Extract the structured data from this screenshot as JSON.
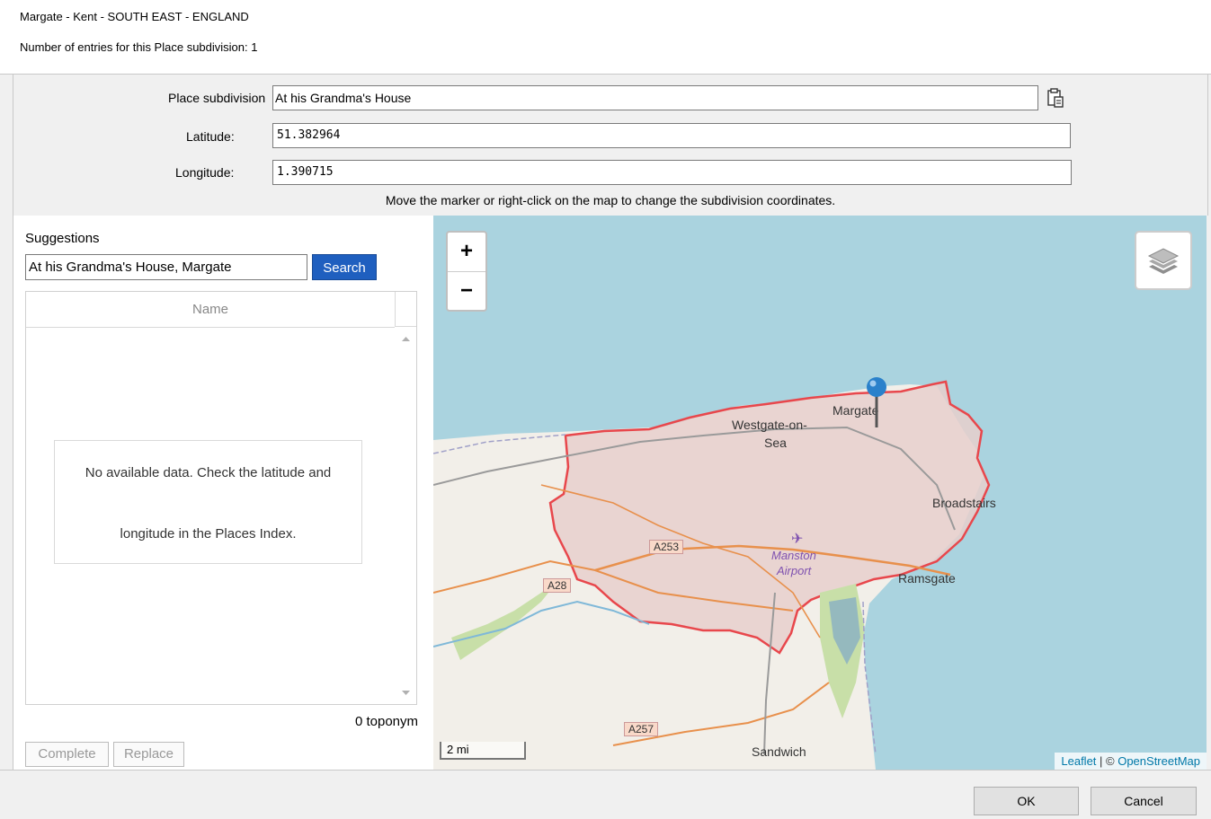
{
  "header": {
    "place_title": "Margate - Kent - SOUTH EAST - ENGLAND",
    "entries_count": "Number of entries for this Place subdivision: 1"
  },
  "form": {
    "subdivision_label": "Place subdivision",
    "subdivision_value": "At his Grandma's House",
    "latitude_label": "Latitude:",
    "latitude_value": "51.382964",
    "longitude_label": "Longitude:",
    "longitude_value": "1.390715",
    "hint": "Move the marker or right-click on the map to change the subdivision coordinates.",
    "paste_icon": "clipboard-paste-icon"
  },
  "suggestions": {
    "label": "Suggestions",
    "query": "At his Grandma's House, Margate",
    "search_label": "Search",
    "column_name": "Name",
    "empty_line1": "No available data. Check the latitude and",
    "empty_line2": "longitude in the Places Index.",
    "count": "0 toponym",
    "complete_label": "Complete",
    "replace_label": "Replace"
  },
  "map": {
    "zoom_in": "+",
    "zoom_out": "−",
    "scale": "2 mi",
    "attribution_leaflet": "Leaflet",
    "attribution_sep": " | © ",
    "attribution_osm": "OpenStreetMap",
    "labels": {
      "margate": "Margate",
      "westgate1": "Westgate-on-",
      "westgate2": "Sea",
      "broadstairs": "Broadstairs",
      "manston1": "Manston",
      "manston2": "Airport",
      "ramsgate": "Ramsgate",
      "sandwich": "Sandwich",
      "a253": "A253",
      "a28": "A28",
      "a257": "A257"
    },
    "colors": {
      "sea": "#aad3df",
      "land": "#f2efe9",
      "boundary": "#e8474c",
      "marker": "#2a81cb"
    }
  },
  "dialog": {
    "ok_label": "OK",
    "cancel_label": "Cancel"
  }
}
